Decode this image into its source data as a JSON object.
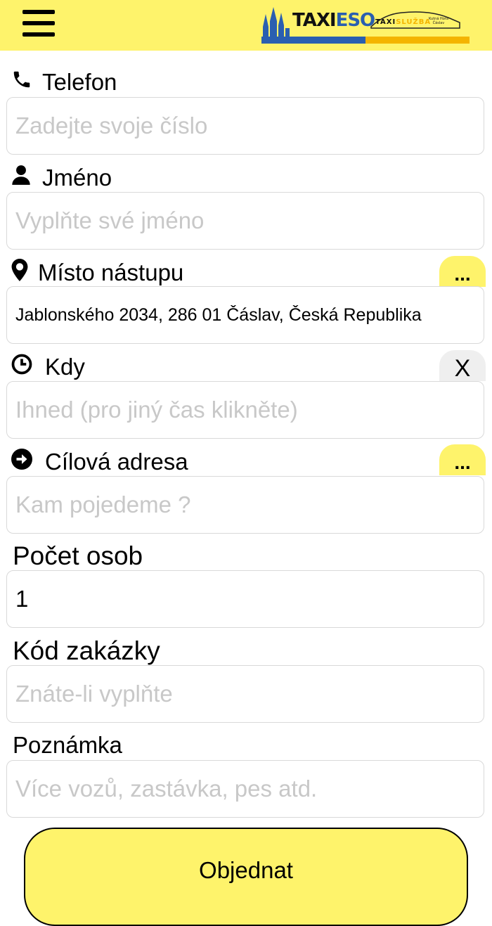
{
  "header": {
    "menu_icon": "hamburger-menu-icon",
    "logo_taxi": "TAXI",
    "logo_eso": "ESO",
    "logo_sluzba_taxi": "TAXI",
    "logo_sluzba_word": "SLUŽBA",
    "logo_town_line1": "Kutná Hora",
    "logo_town_line2": "Čáslav",
    "colors": {
      "bar": "#fef36b",
      "logo_blue": "#2a5fb0",
      "logo_orange": "#f4b400"
    }
  },
  "form": {
    "phone": {
      "icon": "phone-icon",
      "label": "Telefon",
      "placeholder": "Zadejte svoje číslo",
      "value": ""
    },
    "name": {
      "icon": "user-icon",
      "label": "Jméno",
      "placeholder": "Vyplňte své jméno",
      "value": ""
    },
    "pickup": {
      "icon": "map-marker-icon",
      "label": "Místo nástupu",
      "value": "Jablonského 2034, 286 01 Čáslav, Česká Republika",
      "more_label": "..."
    },
    "when": {
      "icon": "clock-icon",
      "label": "Kdy",
      "placeholder": "Ihned (pro jiný čas klikněte)",
      "clear_label": "X"
    },
    "destination": {
      "icon": "arrow-circle-right-icon",
      "label": "Cílová adresa",
      "placeholder": "Kam pojedeme ?",
      "more_label": "..."
    },
    "passengers": {
      "label": "Počet osob",
      "value": "1"
    },
    "order_code": {
      "label": "Kód zakázky",
      "placeholder": "Znáte-li vyplňte"
    },
    "note": {
      "label": "Poznámka",
      "placeholder": "Více vozů, zastávka, pes atd."
    }
  },
  "order_button": {
    "label": "Objednat"
  },
  "colors": {
    "accent": "#fef36b",
    "placeholder": "#c8c8c8",
    "border": "#d9d9d9"
  }
}
